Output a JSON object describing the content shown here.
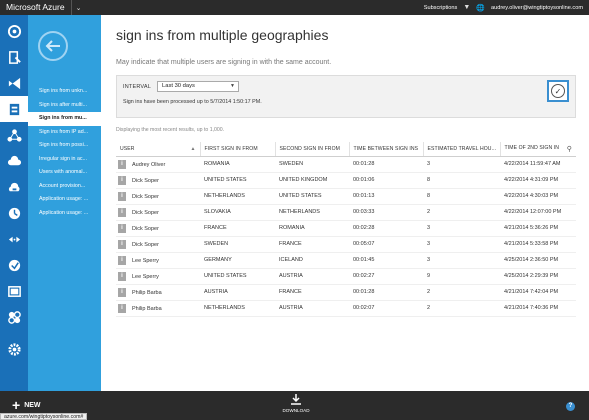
{
  "header": {
    "brand": "Microsoft Azure",
    "subscriptions_label": "Subscriptions",
    "account_email": "audrey.oliver@wingtiptoysonline.com"
  },
  "rail": {
    "accent": "#1a70b8",
    "items": [
      {
        "name": "overview-icon",
        "y": 0
      },
      {
        "name": "sql-icon"
      },
      {
        "name": "visual-studio-icon"
      },
      {
        "name": "directory-icon"
      },
      {
        "name": "network-icon"
      },
      {
        "name": "cloud-services-icon"
      },
      {
        "name": "storage-icon"
      },
      {
        "name": "monitor-icon"
      },
      {
        "name": "connection-icon"
      },
      {
        "name": "scheduler-icon"
      },
      {
        "name": "media-icon"
      },
      {
        "name": "addons-icon"
      },
      {
        "name": "settings-icon"
      }
    ]
  },
  "blade": {
    "accent": "#30a0dd",
    "items": [
      {
        "label": "Sign ins from unkn..."
      },
      {
        "label": "Sign ins after multi..."
      },
      {
        "label": "Sign ins from mu...",
        "active": true
      },
      {
        "label": "Sign ins from IP ad..."
      },
      {
        "label": "Sign ins from possi..."
      },
      {
        "label": "Irregular sign in ac..."
      },
      {
        "label": "Users with anomal..."
      },
      {
        "label": "Account provision..."
      },
      {
        "label": "Application usage: ..."
      },
      {
        "label": "Application usage: ..."
      }
    ]
  },
  "main": {
    "title": "sign ins from multiple geographies",
    "description": "May indicate that multiple users are signing in with the same account.",
    "interval_label": "INTERVAL",
    "interval_value": "Last 30 days",
    "processed_note": "Sign ins have been processed up to 5/7/2014 1:50:17 PM.",
    "recent_note": "Displaying the most recent results, up to 1,000.",
    "columns": [
      "USER",
      "FIRST SIGN IN FROM",
      "SECOND SIGN IN FROM",
      "TIME BETWEEN SIGN INS",
      "ESTIMATED TRAVEL HOU...",
      "TIME OF 2ND SIGN IN"
    ],
    "rows": [
      {
        "user": "Audrey Oliver",
        "first": "ROMANIA",
        "second": "SWEDEN",
        "time_between": "00:01:28",
        "travel": "3",
        "time2": "4/22/2014 11:59:47 AM"
      },
      {
        "user": "Dick Soper",
        "first": "UNITED STATES",
        "second": "UNITED KINGDOM",
        "time_between": "00:01:06",
        "travel": "8",
        "time2": "4/22/2014 4:31:09 PM"
      },
      {
        "user": "Dick Soper",
        "first": "NETHERLANDS",
        "second": "UNITED STATES",
        "time_between": "00:01:13",
        "travel": "8",
        "time2": "4/22/2014 4:30:03 PM"
      },
      {
        "user": "Dick Soper",
        "first": "SLOVAKIA",
        "second": "NETHERLANDS",
        "time_between": "00:03:33",
        "travel": "2",
        "time2": "4/22/2014 12:07:00 PM"
      },
      {
        "user": "Dick Soper",
        "first": "FRANCE",
        "second": "ROMANIA",
        "time_between": "00:02:28",
        "travel": "3",
        "time2": "4/21/2014 5:36:26 PM"
      },
      {
        "user": "Dick Soper",
        "first": "SWEDEN",
        "second": "FRANCE",
        "time_between": "00:05:07",
        "travel": "3",
        "time2": "4/21/2014 5:33:58 PM"
      },
      {
        "user": "Lee Sperry",
        "first": "GERMANY",
        "second": "ICELAND",
        "time_between": "00:01:45",
        "travel": "3",
        "time2": "4/25/2014 2:36:50 PM"
      },
      {
        "user": "Lee Sperry",
        "first": "UNITED STATES",
        "second": "AUSTRIA",
        "time_between": "00:02:27",
        "travel": "9",
        "time2": "4/25/2014 2:29:39 PM"
      },
      {
        "user": "Philip Barba",
        "first": "AUSTRIA",
        "second": "FRANCE",
        "time_between": "00:01:28",
        "travel": "2",
        "time2": "4/21/2014 7:42:04 PM"
      },
      {
        "user": "Philip Barba",
        "first": "NETHERLANDS",
        "second": "AUSTRIA",
        "time_between": "00:02:07",
        "travel": "2",
        "time2": "4/21/2014 7:40:36 PM"
      }
    ]
  },
  "footer": {
    "new_label": "NEW",
    "download_label": "DOWNLOAD",
    "help_label": "?",
    "status_url": "azure.com/wingtiptoysonline.com#"
  }
}
